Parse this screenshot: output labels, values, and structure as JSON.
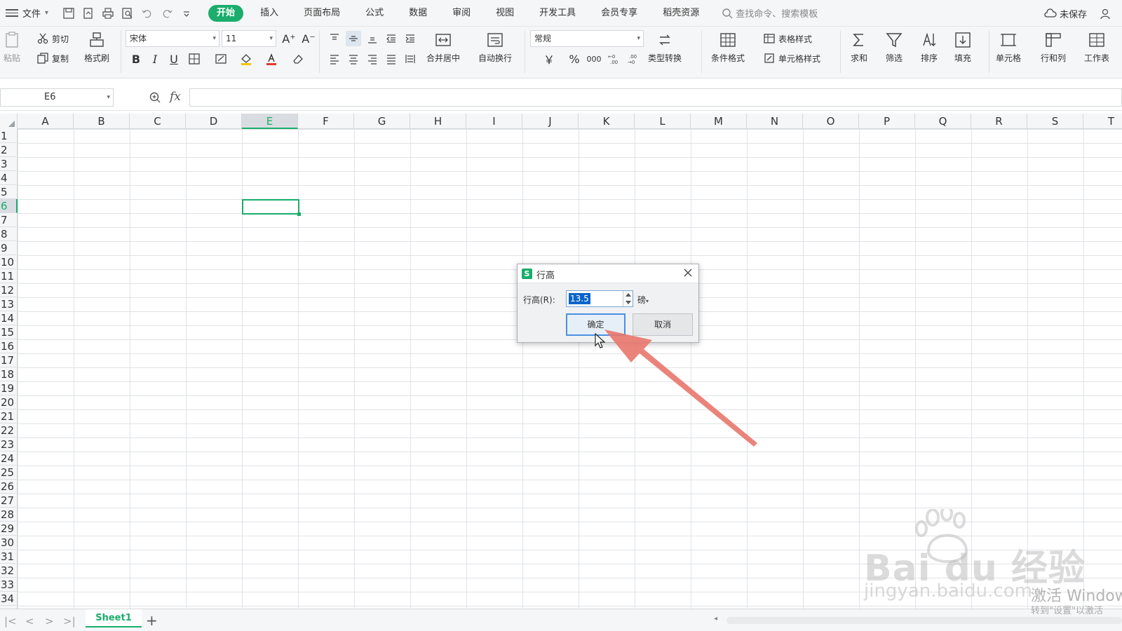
{
  "menubar": {
    "file_label": "文件",
    "tabs": [
      "开始",
      "插入",
      "页面布局",
      "公式",
      "数据",
      "审阅",
      "视图",
      "开发工具",
      "会员专享",
      "稻壳资源"
    ],
    "search_placeholder": "查找命令、搜索模板",
    "save_status": "未保存"
  },
  "ribbon": {
    "paste": "粘贴",
    "cut": "剪切",
    "copy": "复制",
    "format_painter": "格式刷",
    "font_name": "宋体",
    "font_size": "11",
    "merge_center": "合并居中",
    "wrap_text": "自动换行",
    "number_format": "常规",
    "currency_symbol": "￥",
    "percent_symbol": "%",
    "thousands_symbol": "000",
    "type_convert": "类型转换",
    "conditional_format": "条件格式",
    "table_style": "表格样式",
    "cell_style": "单元格样式",
    "sum": "求和",
    "filter": "筛选",
    "sort": "排序",
    "fill": "填充",
    "cell": "单元格",
    "row_col": "行和列",
    "worksheet": "工作表"
  },
  "formulabar": {
    "name_box": "E6",
    "fx_label": "fx"
  },
  "grid": {
    "columns": [
      "A",
      "B",
      "C",
      "D",
      "E",
      "F",
      "G",
      "H",
      "I",
      "J",
      "K",
      "L",
      "M",
      "N",
      "O",
      "P",
      "Q",
      "R",
      "S",
      "T"
    ],
    "rows": [
      "1",
      "2",
      "3",
      "4",
      "5",
      "6",
      "7",
      "8",
      "9",
      "10",
      "11",
      "12",
      "13",
      "14",
      "15",
      "16",
      "17",
      "18",
      "19",
      "20",
      "21",
      "22",
      "23",
      "24",
      "25",
      "26",
      "27",
      "28",
      "29",
      "30",
      "31",
      "32",
      "33",
      "34"
    ],
    "selected_column": "E",
    "selected_row": "6"
  },
  "dialog": {
    "logo": "S",
    "title": "行高",
    "label": "行高(R):",
    "value": "13.5",
    "unit": "磅",
    "ok_label": "确定",
    "cancel_label": "取消"
  },
  "sheetbar": {
    "sheet_name": "Sheet1",
    "add_label": "+"
  },
  "overlay": {
    "watermark_main": "Bai du 经验",
    "watermark_url": "jingyan.baidu.com",
    "activate_line1": "激活 Windows",
    "activate_line2": "转到\"设置\"以激活"
  },
  "colors": {
    "accent": "#1aad6b",
    "arrow": "#e8776b",
    "selection_blue": "#0a64c8"
  }
}
